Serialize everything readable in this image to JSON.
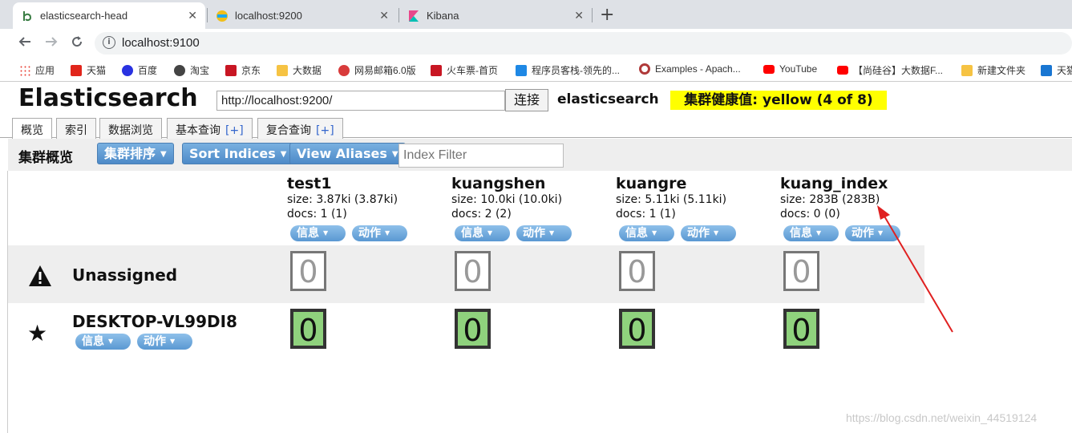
{
  "browser": {
    "tabs": [
      {
        "title": "elasticsearch-head",
        "active": true
      },
      {
        "title": "localhost:9200",
        "active": false
      },
      {
        "title": "Kibana",
        "active": false
      }
    ],
    "close_glyph": "✕",
    "new_tab_glyph": "+",
    "address": "localhost:9100",
    "bookmarks": [
      {
        "label": "应用",
        "color": "#e94235"
      },
      {
        "label": "天猫",
        "color": "#e1251b"
      },
      {
        "label": "百度",
        "color": "#2932e1"
      },
      {
        "label": "淘宝",
        "color": "#444444"
      },
      {
        "label": "京东",
        "color": "#c81623"
      },
      {
        "label": "大数据",
        "color": "#f6c343"
      },
      {
        "label": "网易邮箱6.0版",
        "color": "#d83b3b"
      },
      {
        "label": "火车票-首页",
        "color": "#c81623"
      },
      {
        "label": "程序员客栈-领先的...",
        "color": "#1e88e5"
      },
      {
        "label": "Examples - Apach...",
        "color": "#b03a3a"
      },
      {
        "label": "YouTube",
        "color": "#ff0000"
      },
      {
        "label": "【尚硅谷】大数据F...",
        "color": "#ff0000"
      },
      {
        "label": "新建文件夹",
        "color": "#f6c343"
      },
      {
        "label": "天猫",
        "color": "#1976d2"
      }
    ]
  },
  "header": {
    "title": "Elasticsearch",
    "connect_url": "http://localhost:9200/",
    "connect_label": "连接",
    "cluster_name": "elasticsearch",
    "health": "集群健康值: yellow (4 of 8)"
  },
  "nav": {
    "tabs": [
      {
        "label": "概览",
        "plus": ""
      },
      {
        "label": "索引",
        "plus": ""
      },
      {
        "label": "数据浏览",
        "plus": ""
      },
      {
        "label": "基本查询",
        "plus": "[+]"
      },
      {
        "label": "复合查询",
        "plus": "[+]"
      }
    ]
  },
  "overview": {
    "title": "集群概览",
    "sort_cluster": "集群排序",
    "sort_indices": "Sort Indices",
    "view_aliases": "View Aliases",
    "filter_placeholder": "Index Filter"
  },
  "indices": [
    {
      "name": "test1",
      "size": "size: 3.87ki (3.87ki)",
      "docs": "docs: 1 (1)"
    },
    {
      "name": "kuangshen",
      "size": "size: 10.0ki (10.0ki)",
      "docs": "docs: 2 (2)"
    },
    {
      "name": "kuangre",
      "size": "size: 5.11ki (5.11ki)",
      "docs": "docs: 1 (1)"
    },
    {
      "name": "kuang_index",
      "size": "size: 283B (283B)",
      "docs": "docs: 0 (0)"
    }
  ],
  "buttons": {
    "info": "信息",
    "action": "动作"
  },
  "nodes": {
    "unassigned_label": "Unassigned",
    "node_name": "DESKTOP-VL99DI8"
  },
  "shards": {
    "unassigned": "0",
    "assigned": "0"
  },
  "annotation_color": "#e02020",
  "watermark": "https://blog.csdn.net/weixin_44519124"
}
